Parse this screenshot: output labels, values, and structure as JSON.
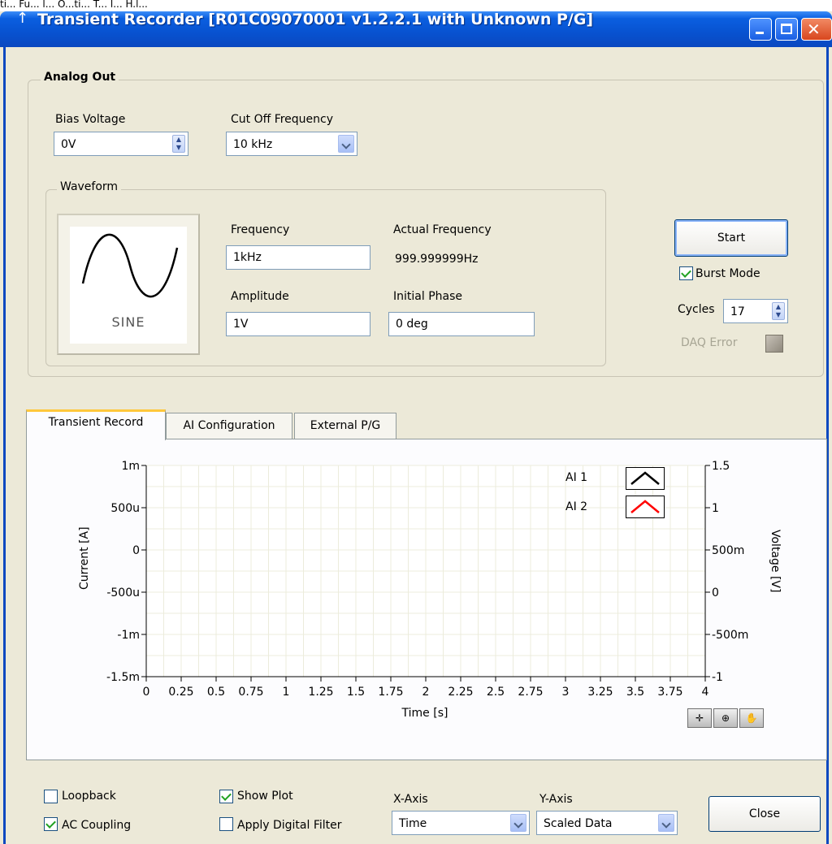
{
  "menu_partial": "ti... Fu... l... O...ti... T... l... H.l...",
  "window": {
    "title": "Transient Recorder [R01C09070001 v1.2.2.1 with Unknown P/G]",
    "icon": "arrow-icon"
  },
  "analog_out": {
    "group_label": "Analog Out",
    "bias_voltage": {
      "label": "Bias Voltage",
      "value": "0V"
    },
    "cutoff": {
      "label": "Cut Off Frequency",
      "value": "10 kHz"
    },
    "waveform": {
      "group_label": "Waveform",
      "preview_label": "SINE",
      "frequency": {
        "label": "Frequency",
        "value": "1kHz"
      },
      "actual_frequency": {
        "label": "Actual Frequency",
        "value": "999.999999Hz"
      },
      "amplitude": {
        "label": "Amplitude",
        "value": "1V"
      },
      "initial_phase": {
        "label": "Initial Phase",
        "value": "0 deg"
      }
    },
    "start_label": "Start",
    "burst_mode": {
      "label": "Burst Mode",
      "checked": true
    },
    "cycles": {
      "label": "Cycles",
      "value": "17"
    },
    "daq_error": {
      "label": "DAQ Error",
      "led_color": "#a09a90"
    }
  },
  "tabs": [
    {
      "label": "Transient Record",
      "active": true
    },
    {
      "label": "AI Configuration",
      "active": false
    },
    {
      "label": "External P/G",
      "active": false
    }
  ],
  "chart_data": {
    "type": "line",
    "xlabel": "Time [s]",
    "ylabel_left": "Current [A]",
    "ylabel_right": "Voltage [V]",
    "x_ticks": [
      "0",
      "0.25",
      "0.5",
      "0.75",
      "1",
      "1.25",
      "1.5",
      "1.75",
      "2",
      "2.25",
      "2.5",
      "2.75",
      "3",
      "3.25",
      "3.5",
      "3.75",
      "4"
    ],
    "y_left_ticks": [
      "1m",
      "500u",
      "0",
      "-500u",
      "-1m",
      "-1.5m"
    ],
    "y_right_ticks": [
      "1.5",
      "1",
      "500m",
      "0",
      "-500m",
      "-1"
    ],
    "xlim": [
      0,
      4
    ],
    "ylim_left": [
      -0.0015,
      0.001
    ],
    "ylim_right": [
      -1,
      1.5
    ],
    "grid": true,
    "legend_position": "top-right",
    "series": [
      {
        "name": "AI 1",
        "color": "#000000",
        "values": []
      },
      {
        "name": "AI 2",
        "color": "#ff0000",
        "values": []
      }
    ]
  },
  "graph_tools": [
    "crosshair-icon",
    "zoom-icon",
    "pan-hand-icon"
  ],
  "bottom": {
    "loopback": {
      "label": "Loopback",
      "checked": false
    },
    "ac_coupling": {
      "label": "AC Coupling",
      "checked": true
    },
    "show_plot": {
      "label": "Show Plot",
      "checked": true
    },
    "apply_filter": {
      "label": "Apply Digital Filter",
      "checked": false
    },
    "x_axis": {
      "label": "X-Axis",
      "value": "Time"
    },
    "y_axis": {
      "label": "Y-Axis",
      "value": "Scaled Data"
    },
    "close_label": "Close"
  }
}
